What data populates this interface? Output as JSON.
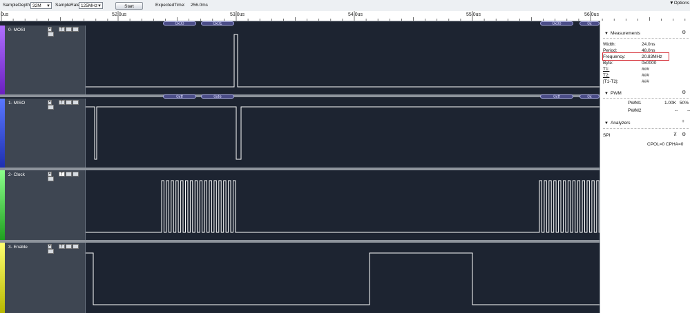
{
  "toolbar": {
    "sample_depth_label": "SampleDepth",
    "sample_depth_value": "32M",
    "sample_rate_label": "SampleRate",
    "sample_rate_value": "125MHz",
    "start_label": "Start",
    "expected_time_label": "ExpectedTime:",
    "expected_time_value": "256.0ms",
    "options_label": "Options"
  },
  "ruler": {
    "labels": [
      "0us",
      "52.0us",
      "53.0us",
      "54.0us",
      "55.0us",
      "56.0us"
    ]
  },
  "channels": [
    {
      "name": "0- MOSI",
      "color": "#8a2be2",
      "decodes": [
        "0x00",
        "0x01",
        "0x00",
        "0x"
      ]
    },
    {
      "name": "1- MISO",
      "color": "#1e3fe0",
      "decodes": [
        "0xff",
        "0xfe",
        "0xff",
        "0x"
      ]
    },
    {
      "name": "2- Clock",
      "color": "#35d435",
      "decodes": []
    },
    {
      "name": "3- Enable",
      "color": "#e8e800",
      "decodes": []
    }
  ],
  "measurements": {
    "title": "Measurements",
    "rows": [
      {
        "key": "Width:",
        "value": "24.0ns"
      },
      {
        "key": "Period:",
        "value": "48.0ns"
      },
      {
        "key": "Frequency:",
        "value": "20.83MHz"
      },
      {
        "key": "Byte:",
        "value": "0x0000"
      },
      {
        "key": "T1:",
        "value": "###"
      },
      {
        "key": "T2:",
        "value": "###"
      },
      {
        "key": "|T1-T2|:",
        "value": "###"
      }
    ]
  },
  "pwm": {
    "title": "PWM",
    "rows": [
      {
        "name": "PWM1",
        "freq": "1.00K",
        "duty": "50%"
      },
      {
        "name": "PWM2",
        "freq": "--",
        "duty": "--"
      }
    ]
  },
  "analyzers": {
    "title": "Analyzers",
    "items": [
      {
        "name": "SPI",
        "detail": "CPOL=0 CPHA=0"
      }
    ]
  },
  "colors": {
    "wave_bg": "#1d2431",
    "highlight": "#d6333b"
  }
}
